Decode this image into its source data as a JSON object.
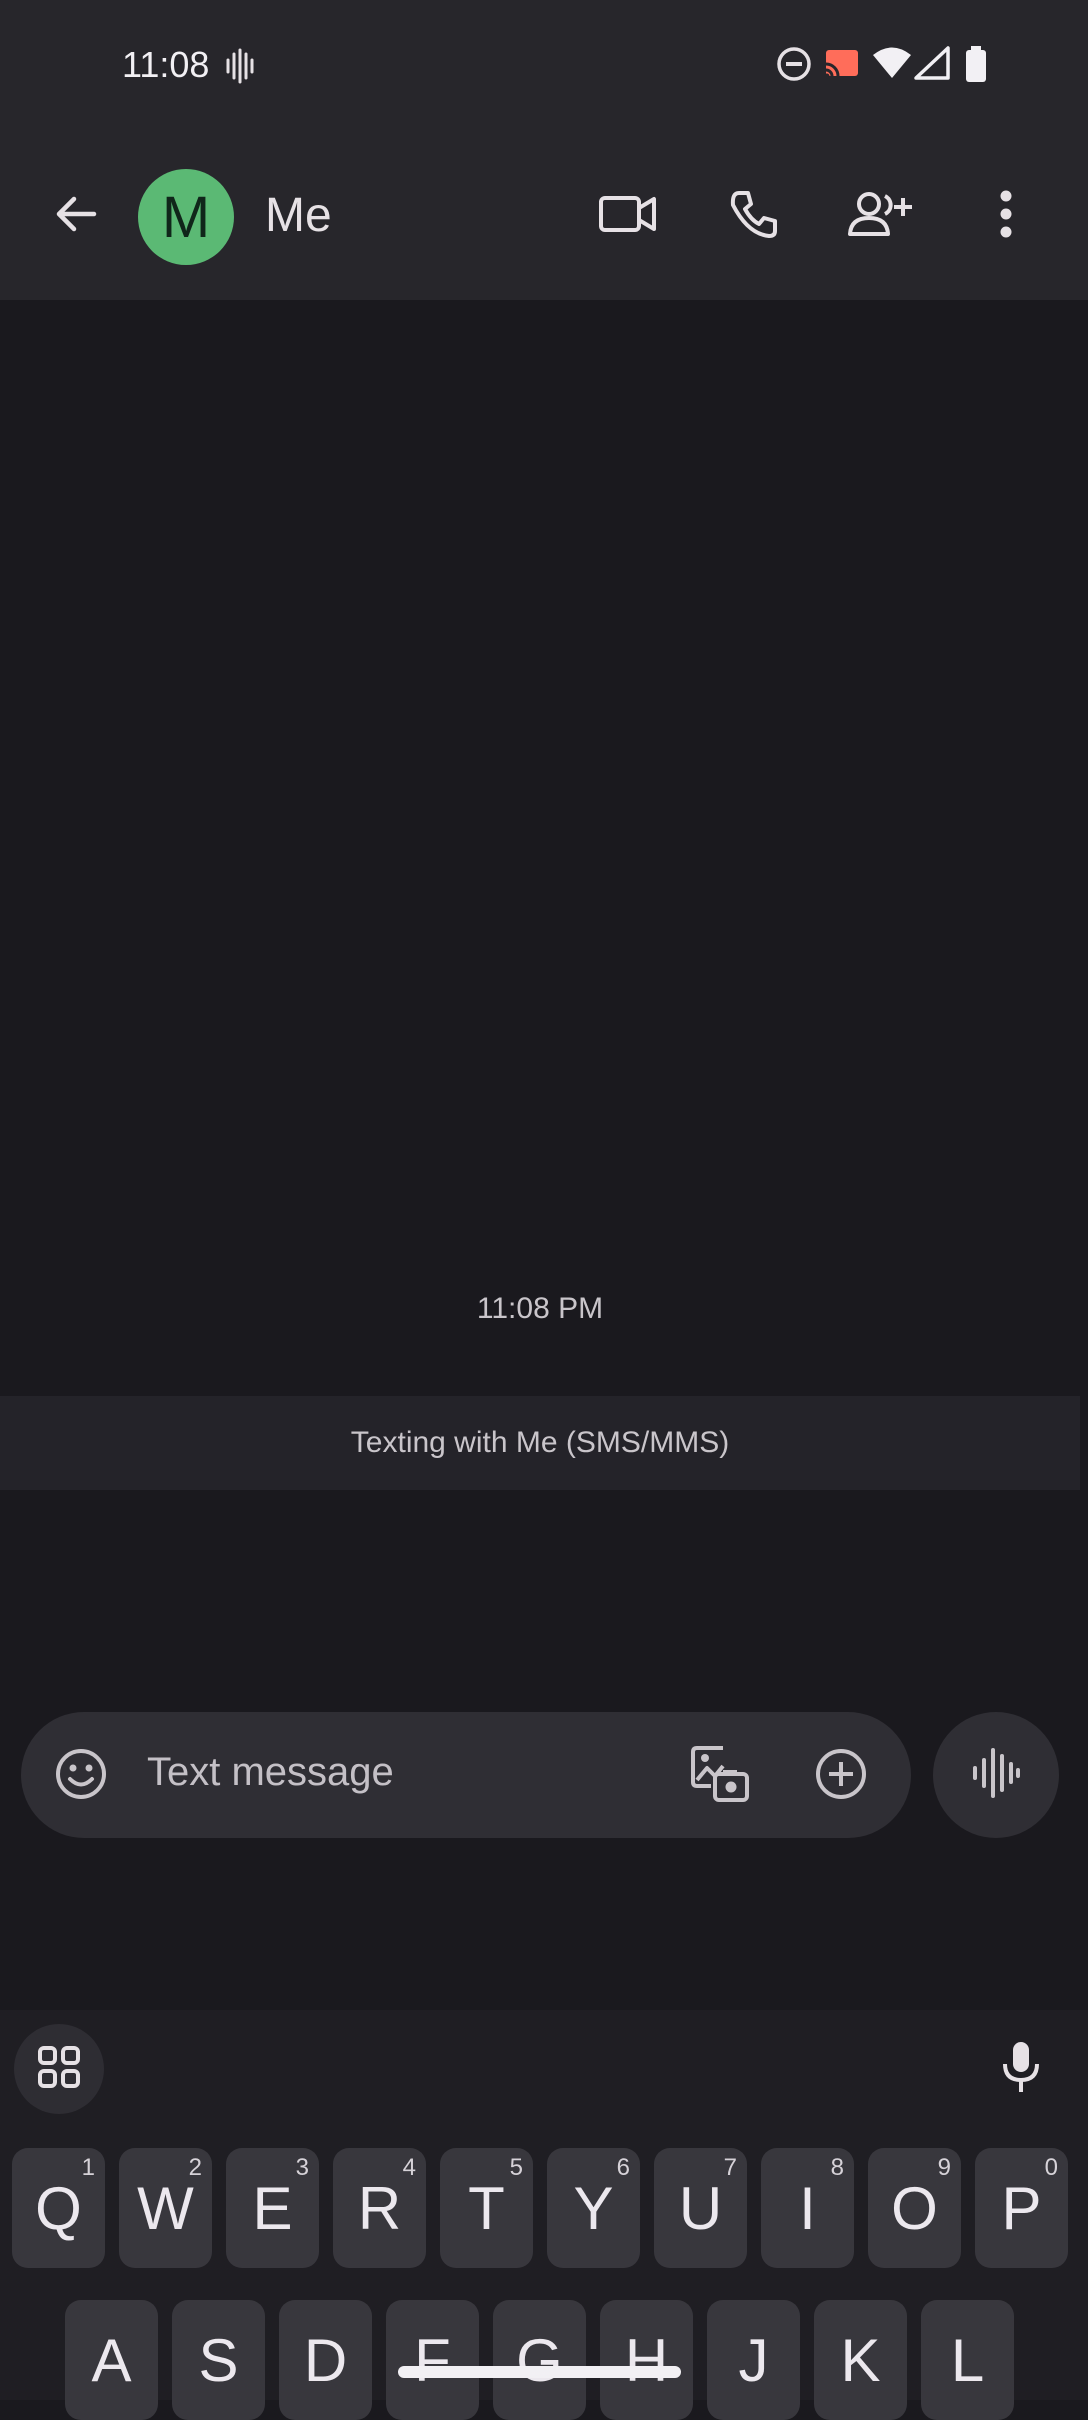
{
  "status_bar": {
    "time": "11:08",
    "icons": [
      "vibrate-icon",
      "dnd-icon",
      "cast-icon",
      "wifi-icon",
      "signal-icon",
      "battery-icon"
    ]
  },
  "app_bar": {
    "contact_initial": "M",
    "contact_name": "Me",
    "avatar_color": "#5bb974",
    "actions": [
      "back-icon",
      "video-call-icon",
      "phone-icon",
      "add-contact-icon",
      "more-vert-icon"
    ]
  },
  "conversation": {
    "timestamp": "11:08 PM",
    "banner": "Texting with Me (SMS/MMS)"
  },
  "compose": {
    "placeholder": "Text message",
    "icons": [
      "emoji-icon",
      "gallery-icon",
      "add-circle-icon",
      "voice-message-icon"
    ]
  },
  "keyboard": {
    "row1": [
      {
        "key": "Q",
        "hint": "1"
      },
      {
        "key": "W",
        "hint": "2"
      },
      {
        "key": "E",
        "hint": "3"
      },
      {
        "key": "R",
        "hint": "4"
      },
      {
        "key": "T",
        "hint": "5"
      },
      {
        "key": "Y",
        "hint": "6"
      },
      {
        "key": "U",
        "hint": "7"
      },
      {
        "key": "I",
        "hint": "8"
      },
      {
        "key": "O",
        "hint": "9"
      },
      {
        "key": "P",
        "hint": "0"
      }
    ],
    "row2": [
      "A",
      "S",
      "D",
      "F",
      "G",
      "H",
      "J",
      "K",
      "L"
    ],
    "toolbar_icons": [
      "apps-grid-icon",
      "mic-icon"
    ]
  }
}
